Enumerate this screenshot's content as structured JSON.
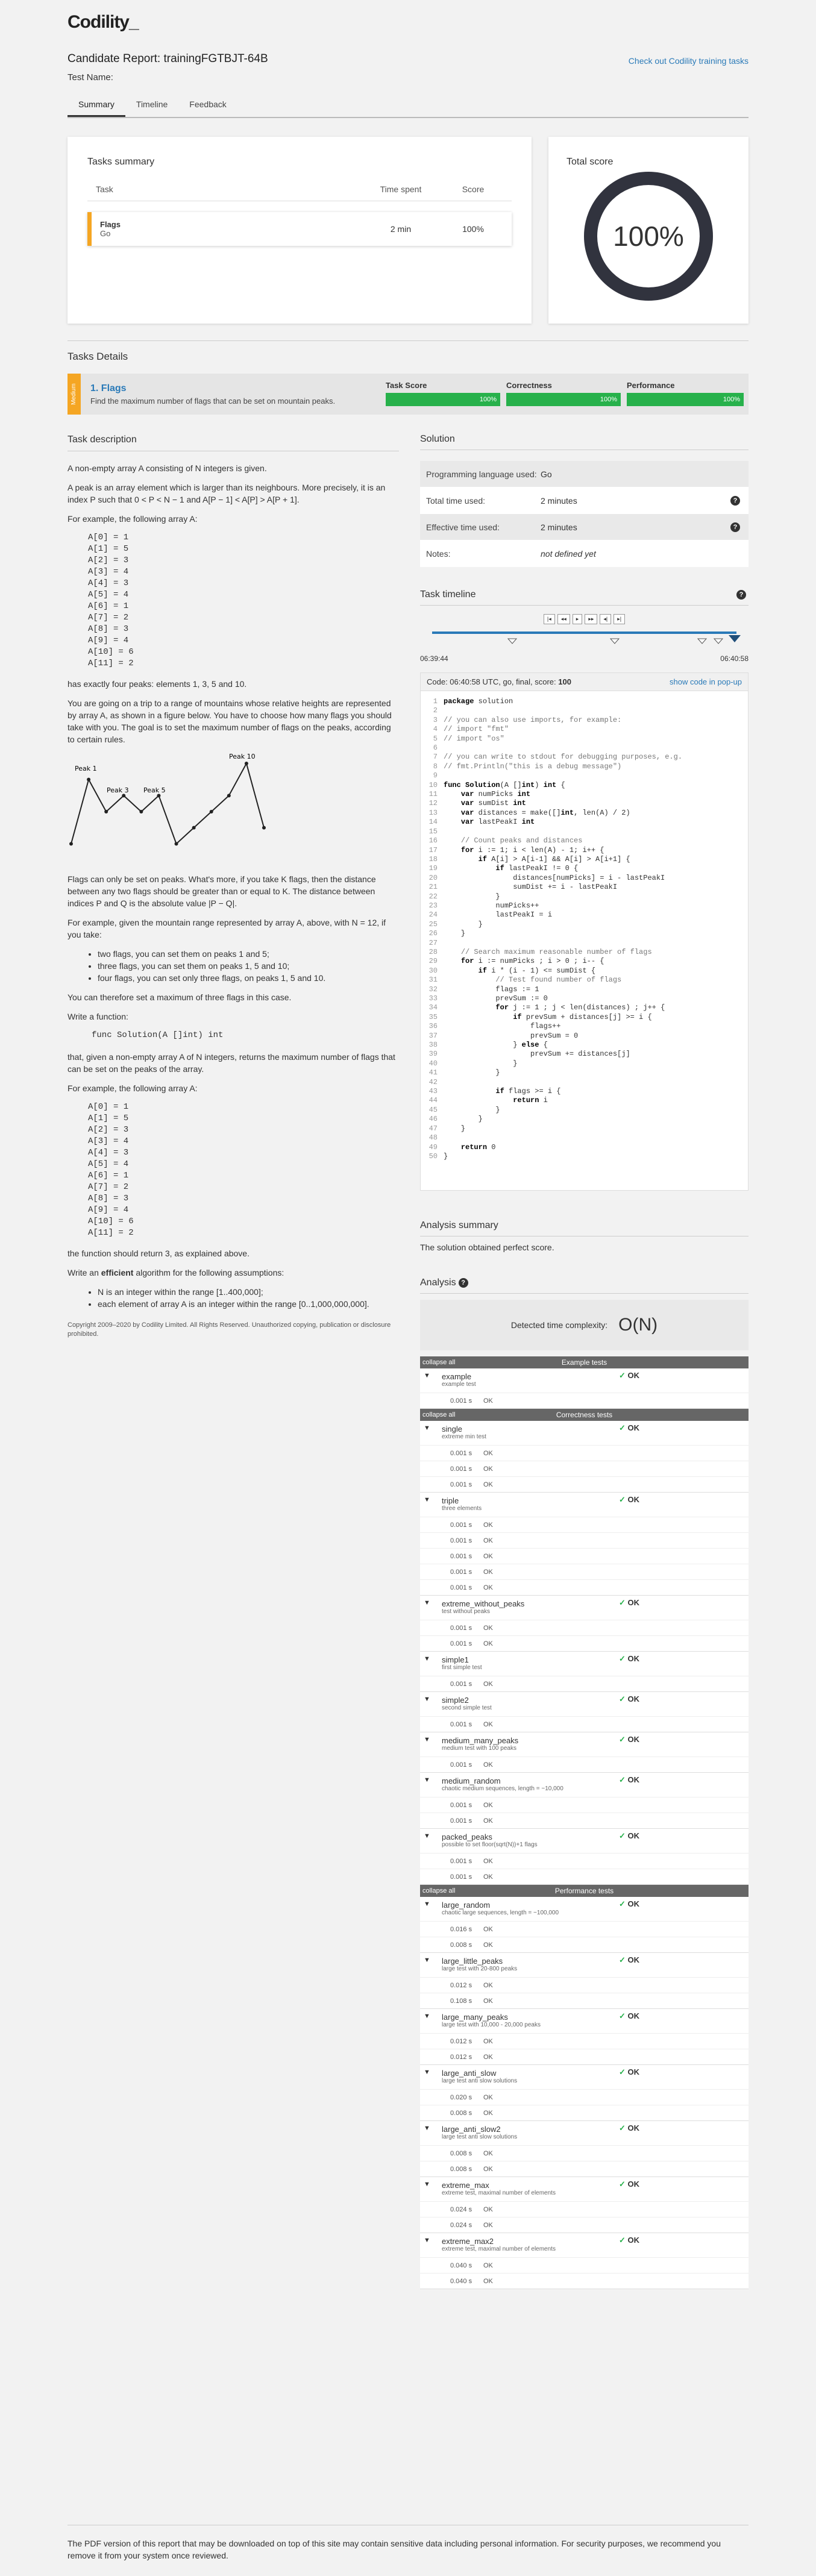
{
  "logo": "Codility_",
  "header": {
    "title": "Candidate Report: trainingFGTBJT-64B",
    "link": "Check out Codility training tasks",
    "test_name": "Test Name:"
  },
  "tabs": [
    "Summary",
    "Timeline",
    "Feedback"
  ],
  "tasks_summary": {
    "title": "Tasks summary",
    "columns": [
      "Task",
      "Time spent",
      "Score"
    ],
    "row": {
      "name": "Flags",
      "lang": "Go",
      "time": "2 min",
      "score": "100%"
    }
  },
  "total_score": {
    "title": "Total score",
    "value": "100%",
    "fraction": 1.0
  },
  "tasks_details": {
    "title": "Tasks Details",
    "badge": "Medium",
    "task_title": "1. Flags",
    "task_subtitle": "Find the maximum number of flags that can be set on mountain peaks.",
    "metrics": [
      {
        "label": "Task Score",
        "value": "100%",
        "fraction": 1.0
      },
      {
        "label": "Correctness",
        "value": "100%",
        "fraction": 1.0
      },
      {
        "label": "Performance",
        "value": "100%",
        "fraction": 1.0
      }
    ]
  },
  "description": {
    "title": "Task description",
    "p1": "A non-empty array A consisting of N integers is given.",
    "p2": "A peak is an array element which is larger than its neighbours. More precisely, it is an index P such that 0 < P < N − 1 and A[P − 1] < A[P] > A[P + 1].",
    "p3": "For example, the following array A:",
    "array": [
      "A[0] = 1",
      "A[1] = 5",
      "A[2] = 3",
      "A[3] = 4",
      "A[4] = 3",
      "A[5] = 4",
      "A[6] = 1",
      "A[7] = 2",
      "A[8] = 3",
      "A[9] = 4",
      "A[10] = 6",
      "A[11] = 2"
    ],
    "p4": "has exactly four peaks: elements 1, 3, 5 and 10.",
    "p5": "You are going on a trip to a range of mountains whose relative heights are represented by array A, as shown in a figure below. You have to choose how many flags you should take with you. The goal is to set the maximum number of flags on the peaks, according to certain rules.",
    "peak_labels": [
      "Peak 1",
      "Peak 3",
      "Peak 5",
      "Peak 10"
    ],
    "p6": "Flags can only be set on peaks. What's more, if you take K flags, then the distance between any two flags should be greater than or equal to K. The distance between indices P and Q is the absolute value |P − Q|.",
    "p7": "For example, given the mountain range represented by array A, above, with N = 12, if you take:",
    "bullets": [
      "two flags, you can set them on peaks 1 and 5;",
      "three flags, you can set them on peaks 1, 5 and 10;",
      "four flags, you can set only three flags, on peaks 1, 5 and 10."
    ],
    "p8": "You can therefore set a maximum of three flags in this case.",
    "p9": "Write a function:",
    "func": "func Solution(A []int) int",
    "p10": "that, given a non-empty array A of N integers, returns the maximum number of flags that can be set on the peaks of the array.",
    "p11": "For example, the following array A:",
    "p12": "the function should return 3, as explained above.",
    "p13_pre": "Write an ",
    "p13_bold": "efficient",
    "p13_post": " algorithm for the following assumptions:",
    "assumptions": [
      "N is an integer within the range [1..400,000];",
      "each element of array A is an integer within the range [0..1,000,000,000]."
    ],
    "copyright": "Copyright 2009–2020 by Codility Limited. All Rights Reserved. Unauthorized copying, publication or disclosure prohibited."
  },
  "solution": {
    "title": "Solution",
    "rows": [
      {
        "k": "Programming language used:",
        "v": "Go",
        "q": ""
      },
      {
        "k": "Total time used:",
        "v": "2 minutes",
        "q": "?"
      },
      {
        "k": "Effective time used:",
        "v": "2 minutes",
        "q": "?"
      },
      {
        "k": "Notes:",
        "v": "not defined yet",
        "q": ""
      }
    ]
  },
  "timeline": {
    "title": "Task timeline",
    "start": "06:39:44",
    "end": "06:40:58",
    "controls": [
      "|◂",
      "◂◂",
      "▸",
      "▸▸",
      "◂|",
      "▸|"
    ]
  },
  "code": {
    "header": "Code: 06:40:58 UTC, go, final, score: ",
    "score": "100",
    "popup": "show code in pop-up"
  },
  "analysis": {
    "summary_title": "Analysis summary",
    "summary_text": "The solution obtained perfect score.",
    "title": "Analysis",
    "complexity_label": "Detected time complexity:",
    "complexity": "O(N)",
    "collapse": "collapse all"
  },
  "groups": [
    {
      "name": "Example tests",
      "tests": [
        {
          "name": "example",
          "desc": "example test",
          "res": "✓ OK",
          "subs": [
            [
              "0.001 s",
              "OK"
            ]
          ]
        }
      ]
    },
    {
      "name": "Correctness tests",
      "tests": [
        {
          "name": "single",
          "desc": "extreme min test",
          "res": "✓ OK",
          "subs": [
            [
              "0.001 s",
              "OK"
            ],
            [
              "0.001 s",
              "OK"
            ],
            [
              "0.001 s",
              "OK"
            ]
          ]
        },
        {
          "name": "triple",
          "desc": "three elements",
          "res": "✓ OK",
          "subs": [
            [
              "0.001 s",
              "OK"
            ],
            [
              "0.001 s",
              "OK"
            ],
            [
              "0.001 s",
              "OK"
            ],
            [
              "0.001 s",
              "OK"
            ],
            [
              "0.001 s",
              "OK"
            ]
          ]
        },
        {
          "name": "extreme_without_peaks",
          "desc": "test without peaks",
          "res": "✓ OK",
          "subs": [
            [
              "0.001 s",
              "OK"
            ],
            [
              "0.001 s",
              "OK"
            ]
          ]
        },
        {
          "name": "simple1",
          "desc": "first simple test",
          "res": "✓ OK",
          "subs": [
            [
              "0.001 s",
              "OK"
            ]
          ]
        },
        {
          "name": "simple2",
          "desc": "second simple test",
          "res": "✓ OK",
          "subs": [
            [
              "0.001 s",
              "OK"
            ]
          ]
        },
        {
          "name": "medium_many_peaks",
          "desc": "medium test with 100 peaks",
          "res": "✓ OK",
          "subs": [
            [
              "0.001 s",
              "OK"
            ]
          ]
        },
        {
          "name": "medium_random",
          "desc": "chaotic medium sequences, length = ~10,000",
          "res": "✓ OK",
          "subs": [
            [
              "0.001 s",
              "OK"
            ],
            [
              "0.001 s",
              "OK"
            ]
          ]
        },
        {
          "name": "packed_peaks",
          "desc": "possible to set floor(sqrt(N))+1 flags",
          "res": "✓ OK",
          "subs": [
            [
              "0.001 s",
              "OK"
            ],
            [
              "0.001 s",
              "OK"
            ]
          ]
        }
      ]
    },
    {
      "name": "Performance tests",
      "tests": [
        {
          "name": "large_random",
          "desc": "chaotic large sequences, length = ~100,000",
          "res": "✓ OK",
          "subs": [
            [
              "0.016 s",
              "OK"
            ],
            [
              "0.008 s",
              "OK"
            ]
          ]
        },
        {
          "name": "large_little_peaks",
          "desc": "large test with 20-800 peaks",
          "res": "✓ OK",
          "subs": [
            [
              "0.012 s",
              "OK"
            ],
            [
              "0.108 s",
              "OK"
            ]
          ]
        },
        {
          "name": "large_many_peaks",
          "desc": "large test with 10,000 - 20,000 peaks",
          "res": "✓ OK",
          "subs": [
            [
              "0.012 s",
              "OK"
            ],
            [
              "0.012 s",
              "OK"
            ]
          ]
        },
        {
          "name": "large_anti_slow",
          "desc": "large test anti slow solutions",
          "res": "✓ OK",
          "subs": [
            [
              "0.020 s",
              "OK"
            ],
            [
              "0.008 s",
              "OK"
            ]
          ]
        },
        {
          "name": "large_anti_slow2",
          "desc": "large test anti slow solutions",
          "res": "✓ OK",
          "subs": [
            [
              "0.008 s",
              "OK"
            ],
            [
              "0.008 s",
              "OK"
            ]
          ]
        },
        {
          "name": "extreme_max",
          "desc": "extreme test, maximal number of elements",
          "res": "✓ OK",
          "subs": [
            [
              "0.024 s",
              "OK"
            ],
            [
              "0.024 s",
              "OK"
            ]
          ]
        },
        {
          "name": "extreme_max2",
          "desc": "extreme test, maximal number of elements",
          "res": "✓ OK",
          "subs": [
            [
              "0.040 s",
              "OK"
            ],
            [
              "0.040 s",
              "OK"
            ]
          ]
        }
      ]
    }
  ],
  "footer": "The PDF version of this report that may be downloaded on top of this site may contain sensitive data including personal information. For security purposes, we recommend you remove it from your system once reviewed."
}
